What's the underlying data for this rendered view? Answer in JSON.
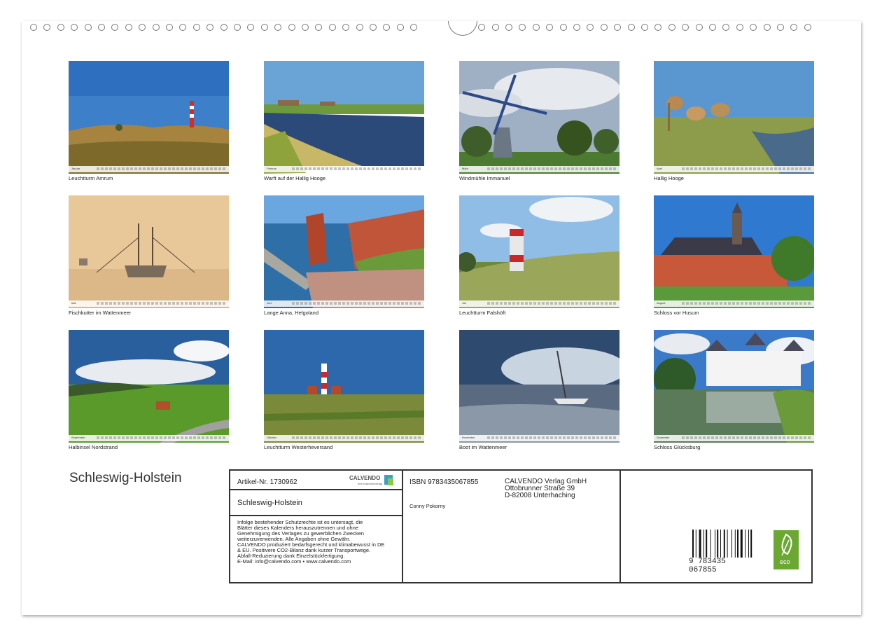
{
  "months": [
    {
      "name": "Januar",
      "caption": "Leuchtturm Amrum"
    },
    {
      "name": "Februar",
      "caption": "Warft auf der Hallig Hooge"
    },
    {
      "name": "März",
      "caption": "Windmühle Immanuel"
    },
    {
      "name": "April",
      "caption": "Hallig Hooge"
    },
    {
      "name": "Mai",
      "caption": "Fischkutter im Wattenmeer"
    },
    {
      "name": "Juni",
      "caption": "Lange Anna, Helgoland"
    },
    {
      "name": "Juli",
      "caption": "Leuchtturm Falshöft"
    },
    {
      "name": "August",
      "caption": "Schloss vor Husum"
    },
    {
      "name": "September",
      "caption": "Halbinsel Nordstrand"
    },
    {
      "name": "Oktober",
      "caption": "Leuchtturm Westerheversand"
    },
    {
      "name": "November",
      "caption": "Boot im Wattenmeer"
    },
    {
      "name": "Dezember",
      "caption": "Schloss Glücksburg"
    }
  ],
  "calendar_title": "Schleswig-Holstein",
  "info": {
    "artikel": "Artikel-Nr. 1730962",
    "brand": "CALVENDO",
    "brand_tagline": "Ihre Kalenderverlag",
    "product_title": "Schleswig-Holstein",
    "legal_lines": [
      "Infolge bestehender Schutzrechte ist es untersagt, die",
      "Blätter dieses Kalenders herauszutrennen und ohne",
      "Genehmigung des Verlages zu gewerblichen Zwecken",
      "weiterzuverwenden. Alle Angaben ohne Gewähr.",
      "CALVENDO produziert bedarfsgerecht und klimabewusst in DE",
      "& EU. Positivere CO2-Bilanz dank kurzer Transportwege.",
      "Abfall-Reduzierung dank Einzelstückfertigung.",
      "E-Mail: info@calvendo.com • www.calvendo.com"
    ],
    "isbn": "ISBN 9783435067855",
    "author": "Conny Pokorny",
    "publisher": [
      "CALVENDO Verlag GmbH",
      "Ottobrunner Straße 39",
      "D-82008 Unterhaching"
    ],
    "barcode_number": "9 783435 067855",
    "eco_label": "eco"
  },
  "colors": {
    "accent_green": "#6aa832",
    "border": "#333333"
  }
}
